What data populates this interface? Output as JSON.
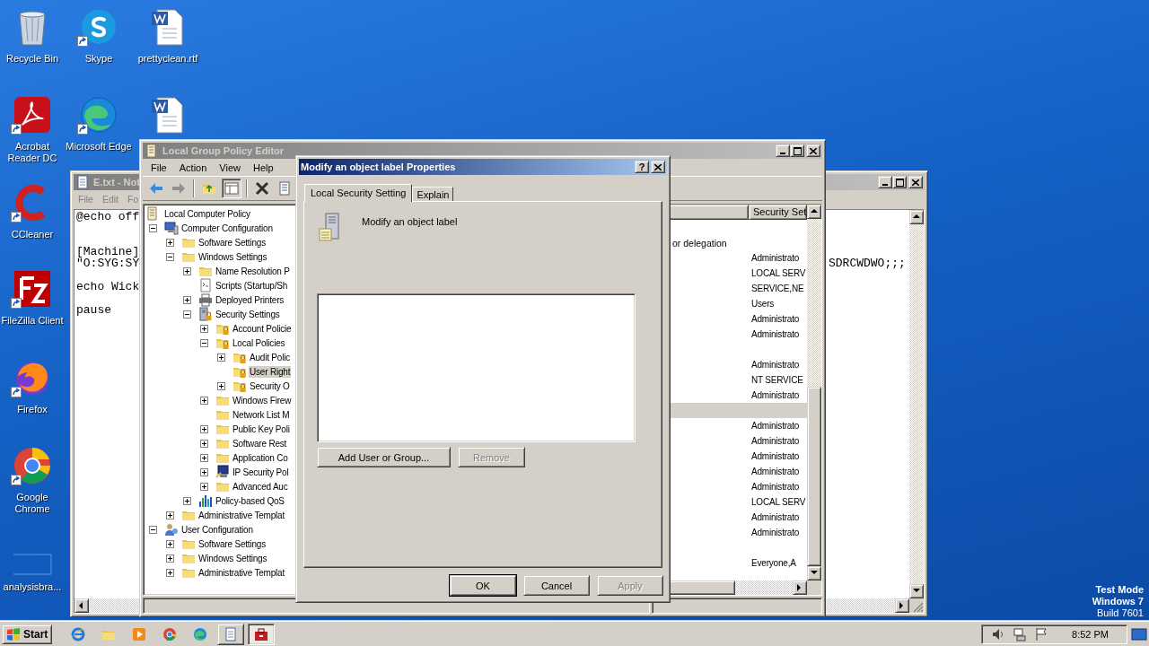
{
  "desktop": {
    "icons": [
      {
        "label": "Recycle Bin",
        "kind": "recycle",
        "shortcut": false
      },
      {
        "label": "Skype",
        "kind": "skype",
        "shortcut": true
      },
      {
        "label": "prettyclean.rtf",
        "kind": "word",
        "shortcut": false
      },
      {
        "label": "Acrobat Reader DC",
        "kind": "acrobat",
        "shortcut": true
      },
      {
        "label": "Microsoft Edge",
        "kind": "edge",
        "shortcut": true
      },
      {
        "kind": "word",
        "shortcut": false
      },
      {
        "label": "CCleaner",
        "kind": "ccleaner",
        "shortcut": true
      },
      {
        "label": "FileZilla Client",
        "kind": "filezilla",
        "shortcut": true
      },
      {
        "label": "Firefox",
        "kind": "firefox",
        "shortcut": true
      },
      {
        "label": "Google Chrome",
        "kind": "chrome",
        "shortcut": true
      },
      {
        "label": "analysisbra...",
        "kind": "blank",
        "shortcut": false
      }
    ],
    "system_info": [
      "Test Mode",
      "Windows 7",
      "Build 7601"
    ]
  },
  "notepad": {
    "title": "E.txt - Not",
    "menu": [
      "File",
      "Edit",
      "Fo"
    ],
    "lines": [
      {
        "kind": "text",
        "left": "@echo off"
      },
      {
        "kind": "blank"
      },
      {
        "kind": "blank"
      },
      {
        "kind": "text",
        "left": "[Machine]"
      },
      {
        "kind": "text",
        "left": "\"O:SYG:SY",
        "right": "SDRCWDWO;;;"
      },
      {
        "kind": "blank"
      },
      {
        "kind": "text",
        "left": "echo Wick"
      },
      {
        "kind": "blank"
      },
      {
        "kind": "text",
        "left": "pause"
      }
    ]
  },
  "gpe": {
    "title": "Local Group Policy Editor",
    "menu": [
      "File",
      "Action",
      "View",
      "Help"
    ],
    "tree": [
      {
        "label": "Local Computer Policy",
        "kind": "policy",
        "selected": false,
        "children": [
          {
            "label": "Computer Configuration",
            "kind": "computer",
            "expanded": true,
            "selected": false,
            "children": [
              {
                "label": "Software Settings",
                "kind": "folder",
                "expanded": false,
                "selected": false
              },
              {
                "label": "Windows Settings",
                "kind": "folder",
                "expanded": true,
                "selected": false,
                "children": [
                  {
                    "label": "Name Resolution P",
                    "kind": "folder",
                    "expanded": false,
                    "selected": false
                  },
                  {
                    "label": "Scripts (Startup/Sh",
                    "kind": "script",
                    "selected": false
                  },
                  {
                    "label": "Deployed Printers",
                    "kind": "printer",
                    "expanded": false,
                    "selected": false
                  },
                  {
                    "label": "Security Settings",
                    "kind": "security",
                    "expanded": true,
                    "selected": false,
                    "children": [
                      {
                        "label": "Account Policie",
                        "kind": "locked-folder",
                        "expanded": false,
                        "selected": false
                      },
                      {
                        "label": "Local Policies",
                        "kind": "locked-folder",
                        "expanded": true,
                        "selected": false,
                        "children": [
                          {
                            "label": "Audit Polic",
                            "kind": "locked-folder",
                            "expanded": false,
                            "selected": false
                          },
                          {
                            "label": "User Right",
                            "kind": "locked-folder",
                            "selected": true
                          },
                          {
                            "label": "Security O",
                            "kind": "locked-folder",
                            "expanded": false,
                            "selected": false
                          }
                        ]
                      },
                      {
                        "label": "Windows Firew",
                        "kind": "folder",
                        "expanded": false,
                        "selected": false
                      },
                      {
                        "label": "Network List M",
                        "kind": "folder",
                        "selected": false
                      },
                      {
                        "label": "Public Key Poli",
                        "kind": "folder",
                        "expanded": false,
                        "selected": false
                      },
                      {
                        "label": "Software Rest",
                        "kind": "folder",
                        "expanded": false,
                        "selected": false
                      },
                      {
                        "label": "Application Co",
                        "kind": "folder",
                        "expanded": false,
                        "selected": false
                      },
                      {
                        "label": "IP Security Pol",
                        "kind": "ipsec",
                        "expanded": false,
                        "selected": false
                      },
                      {
                        "label": "Advanced Auc",
                        "kind": "folder",
                        "expanded": false,
                        "selected": false
                      }
                    ]
                  },
                  {
                    "label": "Policy-based QoS",
                    "kind": "qos",
                    "expanded": false,
                    "selected": false
                  }
                ]
              },
              {
                "label": "Administrative Templat",
                "kind": "folder",
                "expanded": false,
                "selected": false
              }
            ]
          },
          {
            "label": "User Configuration",
            "kind": "user",
            "expanded": true,
            "selected": false,
            "children": [
              {
                "label": "Software Settings",
                "kind": "folder",
                "expanded": false,
                "selected": false
              },
              {
                "label": "Windows Settings",
                "kind": "folder",
                "expanded": false,
                "selected": false
              },
              {
                "label": "Administrative Templat",
                "kind": "folder",
                "expanded": false,
                "selected": false
              }
            ]
          }
        ]
      }
    ],
    "list": {
      "column": "Security Set",
      "rows": [
        {
          "selected": false
        },
        {
          "policy": "or delegation",
          "selected": false
        },
        {
          "setting": "Administrato",
          "selected": false
        },
        {
          "setting": "LOCAL SERV",
          "selected": false
        },
        {
          "setting": "SERVICE,NE",
          "selected": false
        },
        {
          "setting": "Users",
          "selected": false
        },
        {
          "setting": "Administrato",
          "selected": false
        },
        {
          "setting": "Administrato",
          "selected": false
        },
        {
          "selected": false
        },
        {
          "setting": "Administrato",
          "selected": false
        },
        {
          "setting": "NT SERVICE",
          "selected": false
        },
        {
          "setting": "Administrato",
          "selected": false
        },
        {
          "selected": true
        },
        {
          "setting": "Administrato",
          "selected": false
        },
        {
          "setting": "Administrato",
          "selected": false
        },
        {
          "setting": "Administrato",
          "selected": false
        },
        {
          "setting": "Administrato",
          "selected": false
        },
        {
          "setting": "Administrato",
          "selected": false
        },
        {
          "setting": "LOCAL SERV",
          "selected": false
        },
        {
          "setting": "Administrato",
          "selected": false
        },
        {
          "setting": "Administrato",
          "selected": false
        },
        {
          "selected": false
        },
        {
          "setting": "Everyone,A",
          "selected": false
        }
      ]
    }
  },
  "dialog": {
    "title": "Modify an object label Properties",
    "help": "?",
    "tabs": [
      {
        "label": "Local Security Setting",
        "selected": true
      },
      {
        "label": "Explain",
        "selected": false
      }
    ],
    "policy_name": "Modify an object label",
    "list_buttons": [
      {
        "label": "Add User or Group...",
        "disabled": false
      },
      {
        "label": "Remove",
        "disabled": true
      }
    ],
    "footer_buttons": [
      {
        "label": "OK",
        "disabled": false,
        "default": true
      },
      {
        "label": "Cancel",
        "disabled": false,
        "default": false
      },
      {
        "label": "Apply",
        "disabled": true,
        "default": false
      }
    ]
  },
  "taskbar": {
    "start": "Start",
    "apps": [
      {
        "kind": "ie",
        "running": false,
        "selected": false
      },
      {
        "kind": "explorer",
        "running": false,
        "selected": false
      },
      {
        "kind": "media",
        "running": false,
        "selected": false
      },
      {
        "kind": "chrome",
        "running": false,
        "selected": false
      },
      {
        "kind": "edge",
        "running": false,
        "selected": false
      },
      {
        "kind": "notepad",
        "running": true,
        "selected": false
      },
      {
        "kind": "gpe",
        "running": true,
        "selected": true
      }
    ],
    "clock": "8:52 PM"
  }
}
